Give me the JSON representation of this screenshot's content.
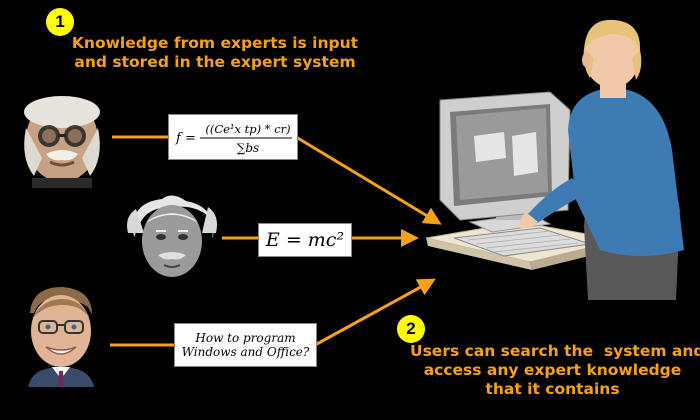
{
  "step1": {
    "number": "1",
    "caption_line1": "Knowledge from experts is input",
    "caption_line2": "and stored in the expert system"
  },
  "step2": {
    "number": "2",
    "caption_line1": "Users can search the  system and",
    "caption_line2": "access any expert knowledge",
    "caption_line3": "that it contains"
  },
  "experts": [
    {
      "portrait": "older-man-with-glasses-photo",
      "formula_lhs": "f =",
      "formula_numerator": "((Ce¹x tp) * cr)",
      "formula_denominator": "∑bs"
    },
    {
      "portrait": "einstein-photo",
      "formula": "E = mc²"
    },
    {
      "portrait": "man-with-glasses-smiling-photo",
      "text_line1": "How to program",
      "text_line2": "Windows and Office?"
    }
  ],
  "colors": {
    "background": "#000000",
    "caption": "#f5a11a",
    "arrow": "#f5a11a",
    "badge": "#ffff00"
  },
  "icons": {
    "user": "person-at-computer-illustration"
  }
}
